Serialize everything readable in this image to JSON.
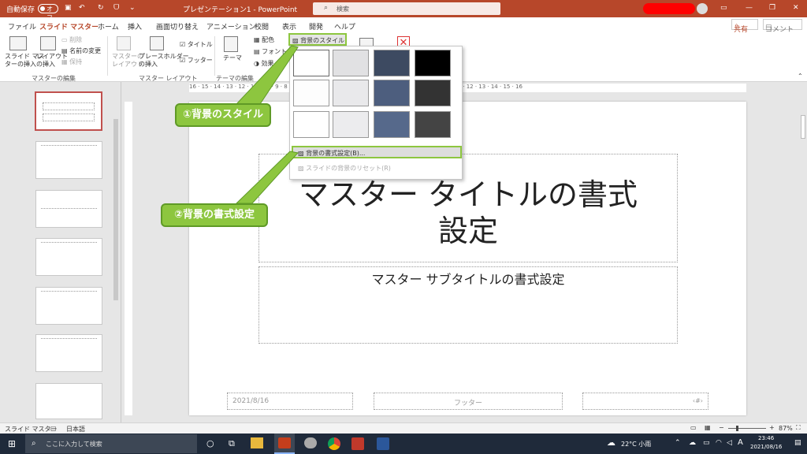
{
  "titlebar": {
    "autosave": "自動保存",
    "toggle": "オフ",
    "doc_title": "プレゼンテーション1  -  PowerPoint",
    "search_placeholder": "検索"
  },
  "menu": {
    "items": [
      "ファイル",
      "スライド マスター",
      "ホーム",
      "挿入",
      "画面切り替え",
      "アニメーション",
      "校閲",
      "表示",
      "開発",
      "ヘルプ"
    ],
    "share": "共有",
    "comment": "コメント"
  },
  "ribbon": {
    "insert_master": "スライド マス\nターの挿入",
    "insert_layout": "レイアウト\nの挿入",
    "delete": "削除",
    "rename": "名前の変更",
    "preserve": "保持",
    "group_edit": "マスターの編集",
    "master_layout": "マスターの\nレイアウト",
    "insert_placeholder": "プレースホルダー\nの挿入",
    "title_chk": "タイトル",
    "footer_chk": "フッター",
    "group_layout": "マスター レイアウト",
    "theme": "テーマ",
    "group_theme": "テーマの編集",
    "colors": "配色",
    "fonts": "フォント",
    "effects": "効果",
    "bg_styles": "背景のスタイル"
  },
  "dropdown": {
    "format_bg": "背景の書式設定(B)...",
    "reset_bg": "スライドの背景のリセット(R)"
  },
  "callouts": {
    "c1": "①背景のスタイル",
    "c2": "②背景の書式設定"
  },
  "slide": {
    "title": "マスター タイトルの書式\n設定",
    "subtitle": "マスター サブタイトルの書式設定",
    "date": "2021/8/16",
    "footer": "フッター",
    "page_no": "‹#›"
  },
  "ruler": {
    "marks": "16 · 15 · 14 · 13 · 12 · 11 · 10 · 9 · 8 · 7 · 6 · 5 · 4 · 3 · 2 · 1 · 0 · 1 · 2 · 3 · 4 · 5 · 6 · 7 · 8 · 9 · 10 · 11 · 12 · 13 · 14 · 15 · 16"
  },
  "status": {
    "view": "スライド マスター",
    "lang": "日本語",
    "zoom": "87%"
  },
  "taskbar": {
    "search": "ここに入力して検索",
    "weather": "22°C 小雨",
    "ime": "A",
    "time": "23:46",
    "date": "2021/08/16"
  },
  "colors": {
    "accent": "#b7472a",
    "callout": "#8dc63f"
  }
}
